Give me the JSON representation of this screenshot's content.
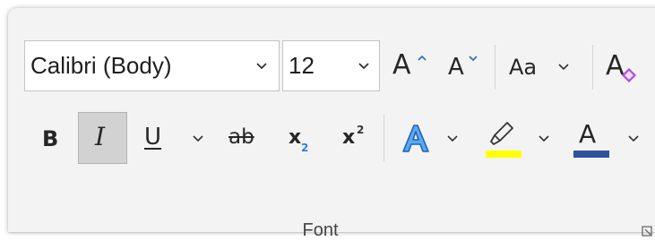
{
  "font_group": {
    "label": "Font",
    "font_name": {
      "value": "Calibri (Body)"
    },
    "font_size": {
      "value": "12"
    },
    "grow_font": {
      "glyph": "A",
      "icon": "increase-font-size-icon"
    },
    "shrink_font": {
      "glyph": "A",
      "icon": "decrease-font-size-icon"
    },
    "change_case": {
      "glyph": "Aa",
      "icon": "change-case-icon"
    },
    "clear_formatting": {
      "glyph": "A",
      "icon": "clear-formatting-icon"
    },
    "bold": {
      "glyph": "B",
      "active": false
    },
    "italic": {
      "glyph": "I",
      "active": true
    },
    "underline": {
      "glyph": "U"
    },
    "strikethrough": {
      "glyph": "ab"
    },
    "subscript": {
      "glyph": "x",
      "sub": "2"
    },
    "superscript": {
      "glyph": "x",
      "sup": "2"
    },
    "text_effects": {
      "glyph": "A",
      "color": "#2e7fd8"
    },
    "highlight": {
      "icon": "highlighter-icon",
      "color": "#ffff00"
    },
    "font_color": {
      "glyph": "A",
      "color": "#2f52a0"
    },
    "dialog_launcher": {
      "icon": "dialog-launcher-icon"
    }
  },
  "colors": {
    "panel_bg": "#f3f3f3",
    "active_button_bg": "#d2d2d2",
    "subscript_blue": "#2e7fd8",
    "eraser_purple": "#b04bd6"
  }
}
